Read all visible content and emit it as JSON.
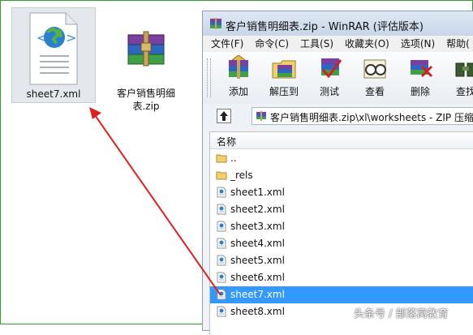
{
  "desktop": {
    "xml_file": {
      "label": "sheet7.xml"
    },
    "zip_file": {
      "label": "客户销售明细表.zip"
    }
  },
  "window": {
    "title": "客户销售明细表.zip - WinRAR (评估版本)",
    "menu": [
      "文件(F)",
      "命令(C)",
      "工具(S)",
      "收藏夹(O)",
      "选项(N)",
      "帮助("
    ],
    "toolbar": [
      {
        "label": "添加",
        "icon": "add-archive-icon"
      },
      {
        "label": "解压到",
        "icon": "extract-icon"
      },
      {
        "label": "测试",
        "icon": "test-icon"
      },
      {
        "label": "查看",
        "icon": "view-icon"
      },
      {
        "label": "删除",
        "icon": "delete-icon"
      },
      {
        "label": "查找",
        "icon": "find-icon"
      }
    ],
    "address": "客户销售明细表.zip\\xl\\worksheets - ZIP 压缩",
    "list_header": "名称",
    "files": [
      {
        "name": "..",
        "type": "folder"
      },
      {
        "name": "_rels",
        "type": "folder"
      },
      {
        "name": "sheet1.xml",
        "type": "xml"
      },
      {
        "name": "sheet2.xml",
        "type": "xml"
      },
      {
        "name": "sheet3.xml",
        "type": "xml"
      },
      {
        "name": "sheet4.xml",
        "type": "xml"
      },
      {
        "name": "sheet5.xml",
        "type": "xml"
      },
      {
        "name": "sheet6.xml",
        "type": "xml"
      },
      {
        "name": "sheet7.xml",
        "type": "xml",
        "selected": true
      },
      {
        "name": "sheet8.xml",
        "type": "xml"
      }
    ]
  },
  "watermark": "头条号 / 部落窝教育",
  "colors": {
    "selection": "#3399ff",
    "arrow": "#e02020",
    "frame": "#2fa02f"
  }
}
